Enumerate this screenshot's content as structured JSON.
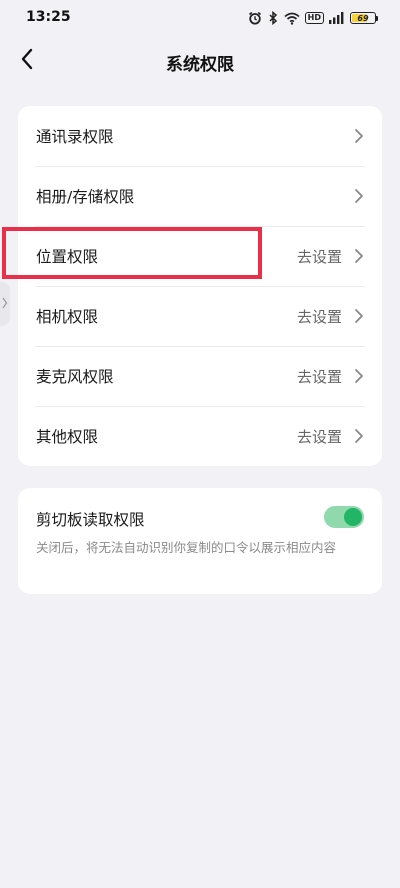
{
  "status_bar": {
    "time": "13:25",
    "hd_label": "HD",
    "battery_level": "69",
    "battery_fraction": 0.69,
    "icons": [
      "alarm-icon",
      "bluetooth-icon",
      "wifi-icon",
      "hd-icon",
      "signal-icon",
      "battery-icon"
    ]
  },
  "header": {
    "title": "系统权限",
    "back_icon": "chevron-left-icon"
  },
  "permissions": [
    {
      "label": "通讯录权限",
      "action": ""
    },
    {
      "label": "相册/存储权限",
      "action": ""
    },
    {
      "label": "位置权限",
      "action": "去设置"
    },
    {
      "label": "相机权限",
      "action": "去设置"
    },
    {
      "label": "麦克风权限",
      "action": "去设置"
    },
    {
      "label": "其他权限",
      "action": "去设置"
    }
  ],
  "clipboard": {
    "title": "剪切板读取权限",
    "description": "关闭后，将无法自动识别你复制的口令以展示相应内容",
    "enabled": true
  },
  "colors": {
    "background": "#f2f2f6",
    "card": "#ffffff",
    "highlight": "#e8304a",
    "toggle_on": "#22b565",
    "battery": "#f4d23c"
  }
}
